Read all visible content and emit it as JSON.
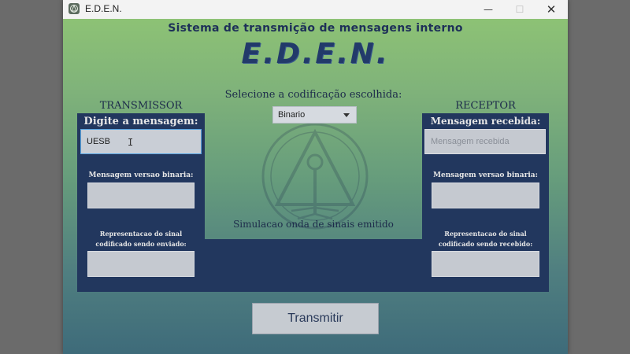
{
  "window": {
    "title": "E.D.E.N.",
    "controls": {
      "minimize": "—",
      "maximize": "☐",
      "close": "✕"
    }
  },
  "header": {
    "title": "Sistema de transmição de mensagens interno",
    "logo": "E.D.E.N."
  },
  "transmitter": {
    "heading": "TRANSMISSOR",
    "message_label": "Digite a mensagem:",
    "message_value": "UESB",
    "binary_label": "Mensagem versao binaria:",
    "binary_value": "",
    "signal_label_line1": "Representacao do sinal",
    "signal_label_line2": "codificado sendo enviado:",
    "signal_value": ""
  },
  "center": {
    "encoding_label": "Selecione a codificação escolhida:",
    "encoding_selected": "Binario",
    "simulation_label": "Simulacao onda de sinais emitido"
  },
  "receiver": {
    "heading": "RECEPTOR",
    "message_label": "Mensagem recebida:",
    "message_placeholder": "Mensagem recebida",
    "binary_label": "Mensagem versao binaria:",
    "binary_value": "",
    "signal_label_line1": "Representacao do sinal",
    "signal_label_line2": "codificado sendo recebido:",
    "signal_value": ""
  },
  "actions": {
    "transmit_label": "Transmitir"
  }
}
